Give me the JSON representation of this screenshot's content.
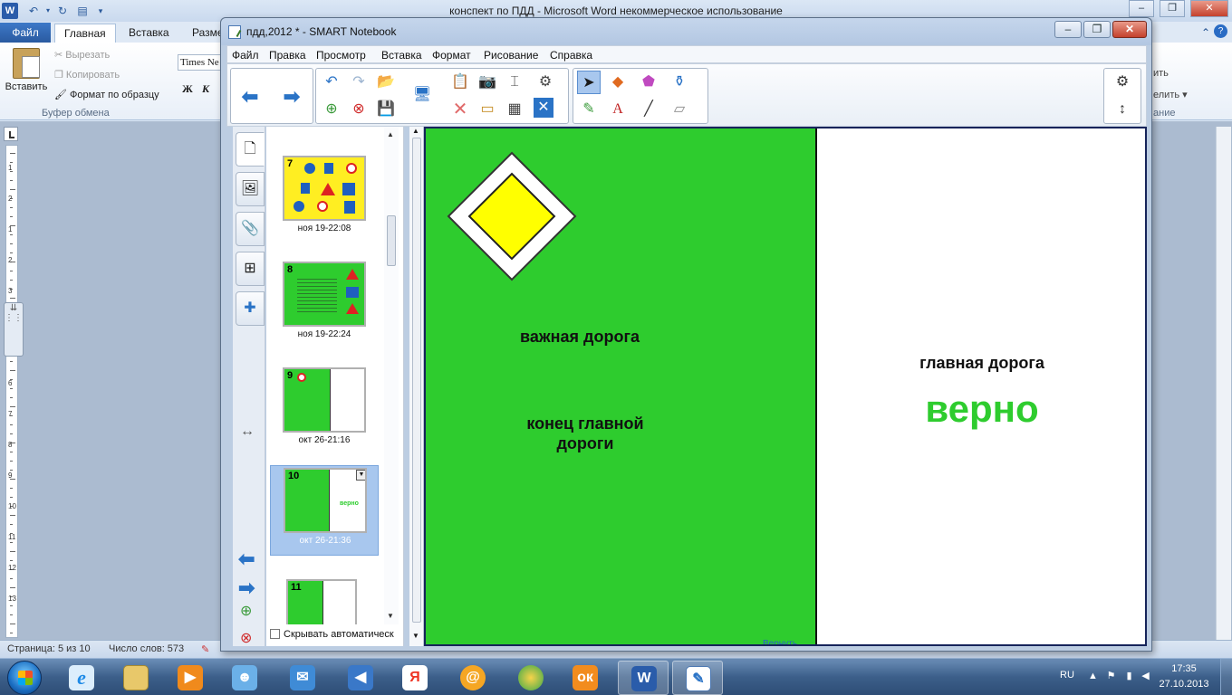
{
  "word": {
    "title": "конспект по ПДД  -  Microsoft Word некоммерческое использование",
    "tabs": {
      "file": "Файл",
      "home": "Главная",
      "insert": "Вставка",
      "layout": "Разме"
    },
    "ribbon": {
      "paste": "Вставить",
      "cut": "Вырезать",
      "copy": "Копировать",
      "format_painter": "Формат по образцу",
      "clipboard_group": "Буфер обмена",
      "font_name": "Times Ne",
      "bold": "Ж",
      "italic": "К",
      "right_1": "ить",
      "right_2": "елить ▾",
      "right_3": "ание"
    },
    "status": {
      "page": "Страница: 5 из 10",
      "words": "Число слов: 573"
    },
    "ruler_numbers": [
      "1",
      "2",
      "1",
      "2",
      "3",
      "4",
      "5",
      "6",
      "7",
      "8",
      "9",
      "10",
      "11",
      "12",
      "13"
    ]
  },
  "taskbar": {
    "language": "RU",
    "time": "17:35",
    "date": "27.10.2013",
    "apps": [
      "ie-icon",
      "explorer-icon",
      "media-player-icon",
      "messenger-icon",
      "mail-icon",
      "sound-icon",
      "yandex-icon",
      "mail-ru-agent-icon",
      "browser-icon",
      "odnoklassniki-icon",
      "word-icon",
      "smart-notebook-icon"
    ],
    "yandex_letter": "Я",
    "word_letter": "W"
  },
  "notebook": {
    "title": "пдд,2012 * - SMART Notebook",
    "menu": [
      "Файл",
      "Правка",
      "Просмотр",
      "Вставка",
      "Формат",
      "Рисование",
      "Справка"
    ],
    "sorter": {
      "pages": [
        {
          "num": "7",
          "label": "ноя 19-22:08"
        },
        {
          "num": "8",
          "label": "ноя 19-22:24"
        },
        {
          "num": "9",
          "label": "окт 26-21:16"
        },
        {
          "num": "10",
          "label": "окт 26-21:36",
          "selected": true,
          "mini_word": "верно"
        },
        {
          "num": "11",
          "label": ""
        }
      ],
      "autohide": "Скрывать автоматическ"
    },
    "page": {
      "text_important": "важная дорога",
      "text_end_main": "конец главной\nдороги",
      "text_main_road": "главная дорога",
      "text_correct": "верно",
      "link": "Вернуть"
    },
    "colors": {
      "slide_green": "#2ecc2e",
      "sign_yellow": "#ffff00",
      "selected_thumb": "#a8c7ee"
    }
  }
}
